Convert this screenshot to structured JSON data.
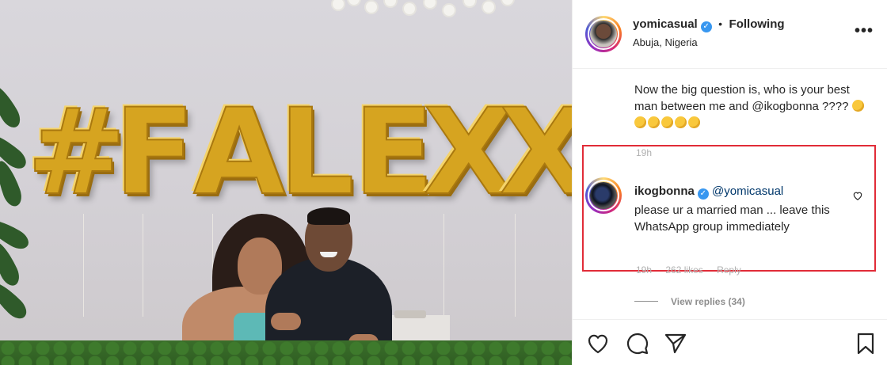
{
  "photo": {
    "balloon_letters": [
      "#",
      "F",
      "A",
      "L",
      "E",
      "X",
      "X"
    ]
  },
  "header": {
    "username": "yomicasual",
    "separator": "•",
    "follow_status": "Following",
    "location": "Abuja, Nigeria",
    "more_label": "•••"
  },
  "caption": {
    "text": "Now the big question is, who is your best man between me and @ikogbonna ????",
    "emoji_count": 6,
    "time": "19h"
  },
  "comment": {
    "username": "ikogbonna",
    "mention": "@yomicasual",
    "text": "please ur a married man ... leave this WhatsApp group immediately",
    "time": "19h",
    "likes": "262 likes",
    "reply_label": "Reply"
  },
  "replies": {
    "label": "View replies (34)"
  },
  "actions": {
    "icons": [
      "heart-icon",
      "comment-icon",
      "share-icon",
      "bookmark-icon"
    ]
  },
  "colors": {
    "highlight_border": "#e12c38",
    "verified_blue": "#3897f0",
    "balloon_gold": "#d6a420"
  }
}
